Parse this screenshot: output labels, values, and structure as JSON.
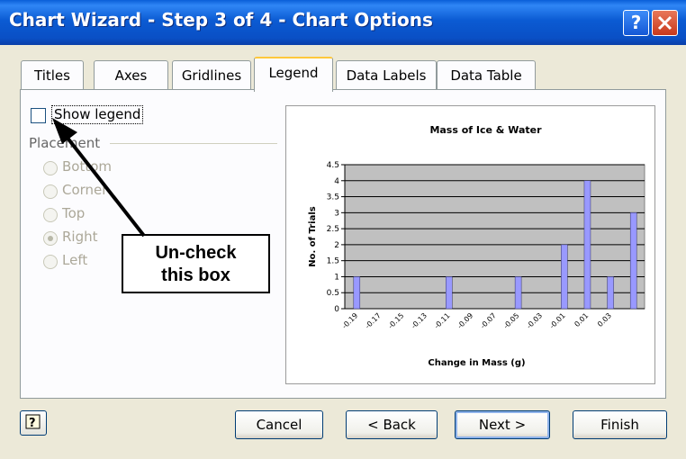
{
  "window": {
    "title": "Chart Wizard - Step 3 of 4 - Chart Options",
    "help_glyph": "?"
  },
  "tabs": [
    {
      "label": "Titles"
    },
    {
      "label": "Axes"
    },
    {
      "label": "Gridlines"
    },
    {
      "label": "Legend",
      "active": true
    },
    {
      "label": "Data Labels"
    },
    {
      "label": "Data Table"
    }
  ],
  "legend": {
    "show_legend_label": "Show legend",
    "show_legend_checked": false,
    "placement_label": "Placement",
    "options": [
      {
        "label": "Bottom",
        "selected": false
      },
      {
        "label": "Corner",
        "selected": false
      },
      {
        "label": "Top",
        "selected": false
      },
      {
        "label": "Right",
        "selected": true
      },
      {
        "label": "Left",
        "selected": false
      }
    ]
  },
  "callout": {
    "line1": "Un-check",
    "line2": "this box"
  },
  "chart_data": {
    "type": "bar",
    "title": "Mass of Ice & Water",
    "xlabel": "Change in Mass (g)",
    "ylabel": "No. of Trials",
    "ylim": [
      0,
      4.5
    ],
    "yticks": [
      "0",
      "0.5",
      "1",
      "1.5",
      "2",
      "2.5",
      "3",
      "3.5",
      "4",
      "4.5"
    ],
    "categories": [
      "-0.19",
      "-0.17",
      "-0.15",
      "-0.13",
      "-0.11",
      "-0.09",
      "-0.07",
      "-0.05",
      "-0.03",
      "-0.01",
      "0.01",
      "0.03"
    ],
    "values": [
      1,
      0,
      0,
      0,
      1,
      0,
      0,
      1,
      0,
      2,
      4,
      1,
      3
    ],
    "bar_color": "#9999ff",
    "plot_bg": "#c0c0c0",
    "grid": true
  },
  "footer": {
    "cancel": "Cancel",
    "back": "< Back",
    "next": "Next >",
    "finish": "Finish"
  }
}
